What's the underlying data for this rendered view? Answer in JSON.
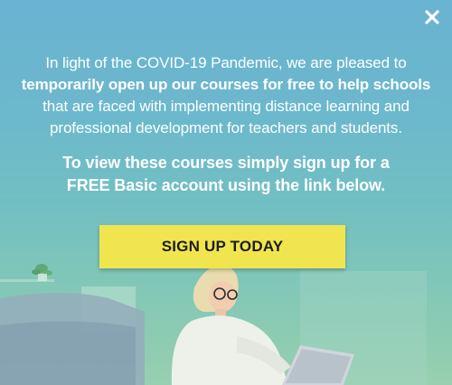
{
  "popup": {
    "intro_before": "In light of the COVID-19 Pandemic, we are pleased to",
    "intro_bold": "temporarily open up our courses for free to help schools",
    "intro_after": "that are faced with implementing distance learning and professional development for teachers and students.",
    "cta_line1": "To view these courses simply sign up for a",
    "cta_line2": "FREE Basic account using the link below.",
    "button_label": "SIGN UP TODAY",
    "close_icon": "close-icon",
    "colors": {
      "button": "#f0e54f",
      "text": "#ffffff",
      "gradient_top": "#6ab3d2",
      "gradient_bottom": "#98cfb0"
    }
  }
}
